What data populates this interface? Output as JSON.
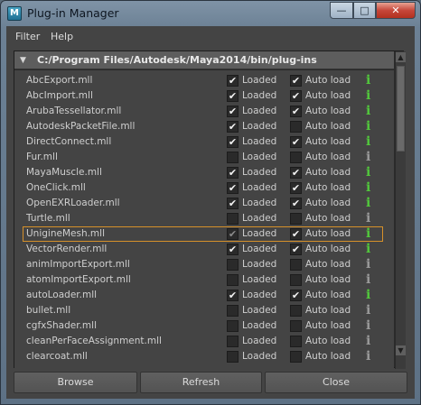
{
  "window": {
    "title": "Plug-in Manager",
    "app_icon": "maya-icon"
  },
  "menu": [
    "Filter",
    "Help"
  ],
  "section": {
    "path": "C:/Program Files/Autodesk/Maya2014/bin/plug-ins"
  },
  "labels": {
    "loaded": "Loaded",
    "auto_load": "Auto load"
  },
  "plugins": [
    {
      "name": "AbcExport.mll",
      "loaded": true,
      "auto_load": true,
      "info_active": true
    },
    {
      "name": "AbcImport.mll",
      "loaded": true,
      "auto_load": true,
      "info_active": true
    },
    {
      "name": "ArubaTessellator.mll",
      "loaded": true,
      "auto_load": true,
      "info_active": true
    },
    {
      "name": "AutodeskPacketFile.mll",
      "loaded": true,
      "auto_load": false,
      "info_active": true
    },
    {
      "name": "DirectConnect.mll",
      "loaded": true,
      "auto_load": true,
      "info_active": true
    },
    {
      "name": "Fur.mll",
      "loaded": false,
      "auto_load": false,
      "info_active": false
    },
    {
      "name": "MayaMuscle.mll",
      "loaded": true,
      "auto_load": true,
      "info_active": true
    },
    {
      "name": "OneClick.mll",
      "loaded": true,
      "auto_load": true,
      "info_active": true
    },
    {
      "name": "OpenEXRLoader.mll",
      "loaded": true,
      "auto_load": true,
      "info_active": true
    },
    {
      "name": "Turtle.mll",
      "loaded": false,
      "auto_load": false,
      "info_active": false
    },
    {
      "name": "UnigineMesh.mll",
      "loaded": true,
      "auto_load": true,
      "info_active": true,
      "selected": true
    },
    {
      "name": "VectorRender.mll",
      "loaded": true,
      "auto_load": true,
      "info_active": true
    },
    {
      "name": "animImportExport.mll",
      "loaded": false,
      "auto_load": false,
      "info_active": false
    },
    {
      "name": "atomImportExport.mll",
      "loaded": false,
      "auto_load": false,
      "info_active": false
    },
    {
      "name": "autoLoader.mll",
      "loaded": true,
      "auto_load": true,
      "info_active": true
    },
    {
      "name": "bullet.mll",
      "loaded": false,
      "auto_load": false,
      "info_active": false
    },
    {
      "name": "cgfxShader.mll",
      "loaded": false,
      "auto_load": false,
      "info_active": false
    },
    {
      "name": "cleanPerFaceAssignment.mll",
      "loaded": false,
      "auto_load": false,
      "info_active": false
    },
    {
      "name": "clearcoat.mll",
      "loaded": false,
      "auto_load": false,
      "info_active": false
    }
  ],
  "buttons": {
    "browse": "Browse",
    "refresh": "Refresh",
    "close": "Close"
  },
  "colors": {
    "info_active": "#52c83c",
    "info_inactive": "#9a9a9a",
    "selection": "#d6902a"
  }
}
